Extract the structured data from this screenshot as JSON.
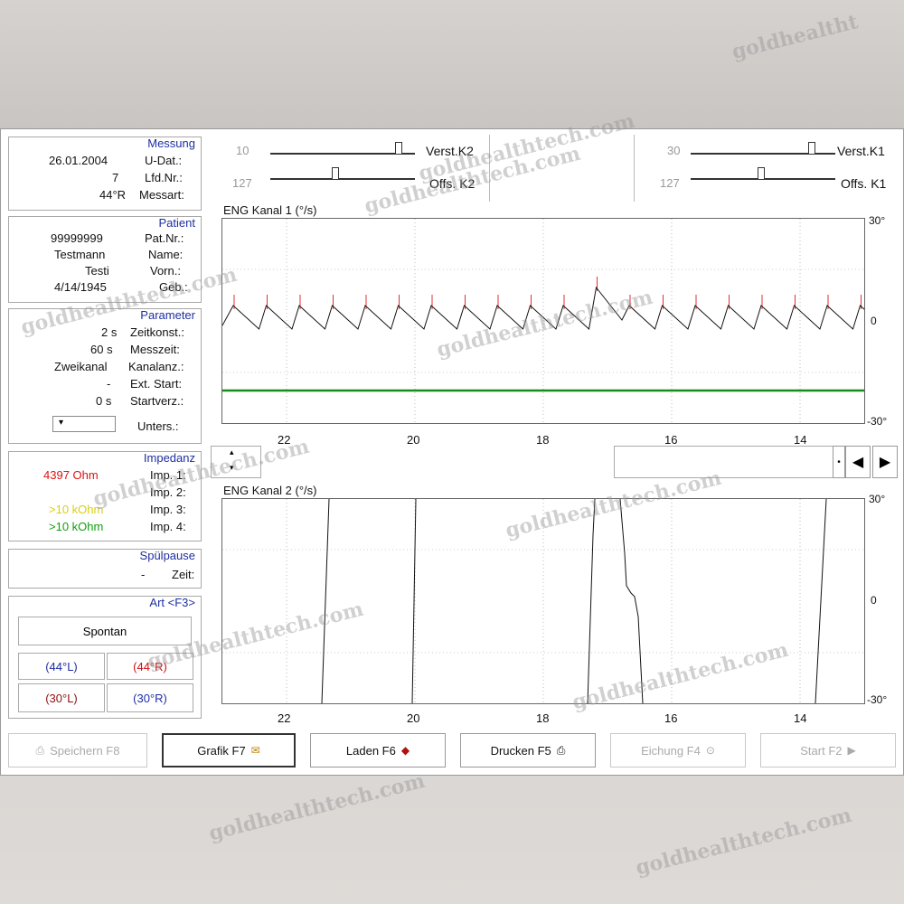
{
  "watermark": "goldhealthtech.com",
  "top_watermark": "goldhealtht",
  "controls": {
    "k2": {
      "verst_label": "Verst.K2",
      "verst_value": "10",
      "offs_label": "Offs. K2",
      "offs_value": "127"
    },
    "k1": {
      "verst_label": "Verst.K1",
      "verst_value": "30",
      "offs_label": "Offs. K1",
      "offs_value": "127"
    }
  },
  "messung": {
    "title": "Messung",
    "rows": [
      {
        "label": "U-Dat.:",
        "value": "26.01.2004"
      },
      {
        "label": "Lfd.Nr.:",
        "value": "7"
      },
      {
        "label": "Messart:",
        "value": "44°R"
      }
    ]
  },
  "patient": {
    "title": "Patient",
    "rows": [
      {
        "label": "Pat.Nr.:",
        "value": "99999999"
      },
      {
        "label": "Name:",
        "value": "Testmann"
      },
      {
        "label": "Vorn.:",
        "value": "Testi"
      },
      {
        "label": "Geb.:",
        "value": "4/14/1945"
      }
    ]
  },
  "parameter": {
    "title": "Parameter",
    "rows": [
      {
        "label": "Zeitkonst.:",
        "value": "2 s"
      },
      {
        "label": "Messzeit:",
        "value": "60 s"
      },
      {
        "label": "Kanalanz.:",
        "value": "Zweikanal"
      },
      {
        "label": "Ext. Start:",
        "value": "-"
      },
      {
        "label": "Startverz.:",
        "value": "0 s"
      }
    ],
    "unters_label": "Unters.:"
  },
  "impedanz": {
    "title": "Impedanz",
    "rows": [
      {
        "label": "Imp. 1:",
        "value": "4397 Ohm",
        "color": "#e01010"
      },
      {
        "label": "Imp. 2:",
        "value": "",
        "color": "#111111"
      },
      {
        "label": "Imp. 3:",
        "value": ">10 kOhm",
        "color": "#e8e020"
      },
      {
        "label": "Imp. 4:",
        "value": ">10 kOhm",
        "color": "#10a010"
      }
    ]
  },
  "spuelpause": {
    "title": "Spülpause",
    "zeit_label": "Zeit:",
    "zeit_value": "-"
  },
  "art": {
    "title": "Art <F3>",
    "spontan": "Spontan",
    "b44L": "(44°L)",
    "b44R": "(44°R)",
    "b30L": "(30°L)",
    "b30R": "(30°R)"
  },
  "chart1": {
    "title": "ENG Kanal 1 (°/s)",
    "yticks": [
      "30°",
      "0",
      "-30°"
    ],
    "xticks": [
      "22",
      "20",
      "18",
      "16",
      "14"
    ]
  },
  "chart2": {
    "title": "ENG Kanal 2 (°/s)",
    "yticks": [
      "30°",
      "0",
      "-30°"
    ],
    "xticks": [
      "22",
      "20",
      "18",
      "16",
      "14"
    ]
  },
  "buttons": {
    "speichern": "Speichern F8",
    "grafik": "Grafik F7",
    "laden": "Laden F6",
    "drucken": "Drucken F5",
    "eichung": "Eichung F4",
    "start": "Start F2"
  },
  "colors": {
    "accent_title": "#1e2fa3",
    "trace": "#111111",
    "spike": "#e03030",
    "baseline": "#1a8a1a"
  }
}
